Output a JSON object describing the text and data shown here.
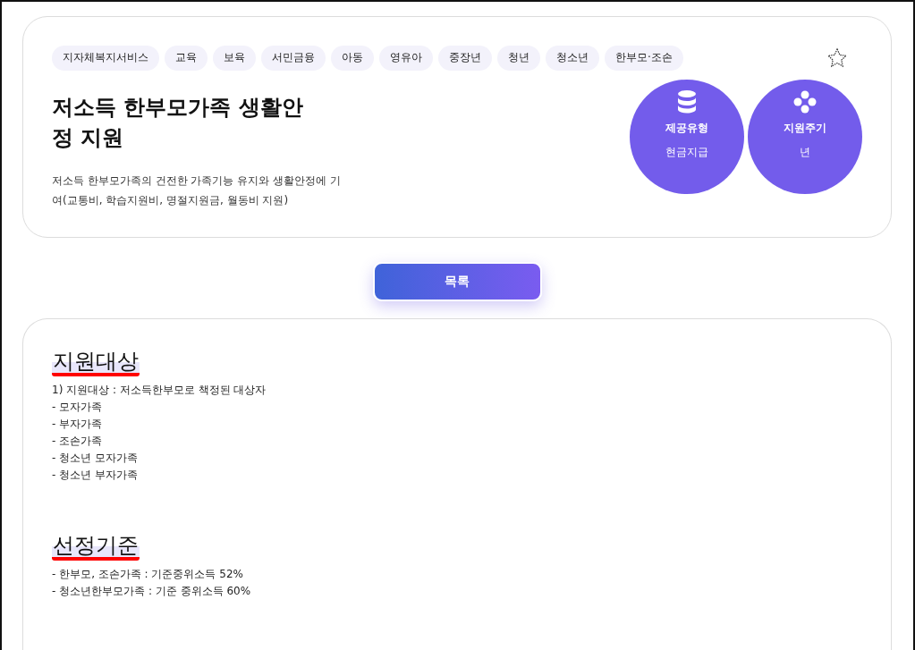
{
  "tags": [
    "지자체복지서비스",
    "교육",
    "보육",
    "서민금융",
    "아동",
    "영유아",
    "중장년",
    "청년",
    "청소년",
    "한부모·조손"
  ],
  "favorite": {
    "on": false
  },
  "title": "저소득 한부모가족 생활안정 지원",
  "description": "저소득 한부모가족의 건전한 가족기능 유지와 생활안정에 기여(교통비, 학습지원비, 명절지원금, 월동비 지원)",
  "info_circles": [
    {
      "kind": "database",
      "label": "제공유형",
      "value": "현금지급"
    },
    {
      "kind": "dots",
      "label": "지원주기",
      "value": "년"
    }
  ],
  "list_button": "목록",
  "sections": [
    {
      "heading": "지원대상",
      "lines": [
        "1) 지원대상 : 저소득한부모로 책정된 대상자",
        "- 모자가족",
        "- 부자가족",
        "- 조손가족",
        "- 청소년 모자가족",
        "- 청소년 부자가족"
      ]
    },
    {
      "heading": "선정기준",
      "lines": [
        "- 한부모, 조손가족 : 기준중위소득 52%",
        "- 청소년한부모가족 : 기준 중위소득 60%"
      ]
    }
  ]
}
